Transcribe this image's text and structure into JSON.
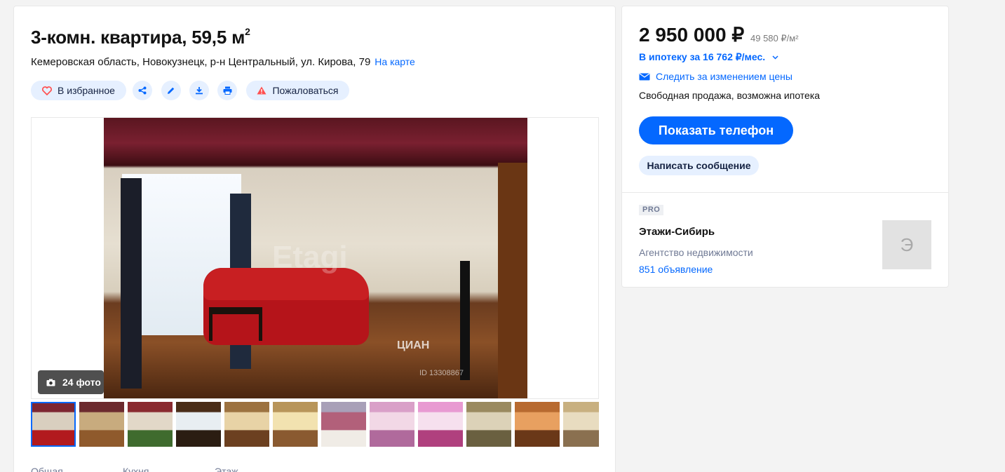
{
  "listing": {
    "title": "3-комн. квартира, 59,5 м",
    "title_sup": "2",
    "address": "Кемеровская область, Новокузнецк, р-н Центральный, ул. Кирова, 79",
    "map_link": "На карте",
    "actions": {
      "favorite_label": "В избранное",
      "report_label": "Пожаловаться",
      "icons": [
        "heart-icon",
        "share-icon",
        "edit-icon",
        "download-icon",
        "print-icon",
        "warning-icon"
      ]
    },
    "gallery": {
      "photo_count_label": "24 фото",
      "watermark": "ЦИАН",
      "watermark_id": "ID 13308867",
      "photo_watermark": "Etagi",
      "thumbnails": [
        {
          "index": 1,
          "active": true,
          "colors": [
            "#7d2632",
            "#d9cfbf",
            "#b21a1e"
          ]
        },
        {
          "index": 2,
          "active": false,
          "colors": [
            "#6c2a2e",
            "#c8ab7e",
            "#8f5a2c"
          ]
        },
        {
          "index": 3,
          "active": false,
          "colors": [
            "#8a2a30",
            "#e2d8c8",
            "#3f6b2e"
          ]
        },
        {
          "index": 4,
          "active": false,
          "colors": [
            "#4a2d18",
            "#e8eef2",
            "#2b1d12"
          ]
        },
        {
          "index": 5,
          "active": false,
          "colors": [
            "#9c7240",
            "#e8d3a6",
            "#6c4020"
          ]
        },
        {
          "index": 6,
          "active": false,
          "colors": [
            "#b8955a",
            "#f2e2b0",
            "#8a5a30"
          ]
        },
        {
          "index": 7,
          "active": false,
          "colors": [
            "#a8a0b8",
            "#b2607a",
            "#f0ece6"
          ]
        },
        {
          "index": 8,
          "active": false,
          "colors": [
            "#d9a0c8",
            "#f2d8e6",
            "#b06a9c"
          ]
        },
        {
          "index": 9,
          "active": false,
          "colors": [
            "#e89ad2",
            "#f6e0ee",
            "#b0407e"
          ]
        },
        {
          "index": 10,
          "active": false,
          "colors": [
            "#9a8a60",
            "#dcd2b8",
            "#6a6040"
          ]
        },
        {
          "index": 11,
          "active": false,
          "colors": [
            "#b86a30",
            "#e8a060",
            "#6a3818"
          ]
        },
        {
          "index": 12,
          "active": false,
          "colors": [
            "#c8b080",
            "#e8dcc0",
            "#8a7050"
          ]
        }
      ]
    },
    "specs": [
      "Общая",
      "Кухня",
      "Этаж"
    ]
  },
  "offer": {
    "price": "2 950 000 ₽",
    "price_per_m2": "49 580 ₽/м²",
    "mortgage": "В ипотеку за 16 762 ₽/мес.",
    "follow_price": "Следить за изменением цены",
    "sale_terms": "Свободная продажа, возможна ипотека",
    "show_phone": "Показать телефон",
    "write_message": "Написать сообщение"
  },
  "agent": {
    "badge": "PRO",
    "name": "Этажи-Сибирь",
    "type": "Агентство недвижимости",
    "listings_count": "851 объявление",
    "logo_letter": "Э"
  },
  "colors": {
    "accent": "#0468ff",
    "pill_bg": "#e6f0ff",
    "danger": "#ff5050"
  }
}
